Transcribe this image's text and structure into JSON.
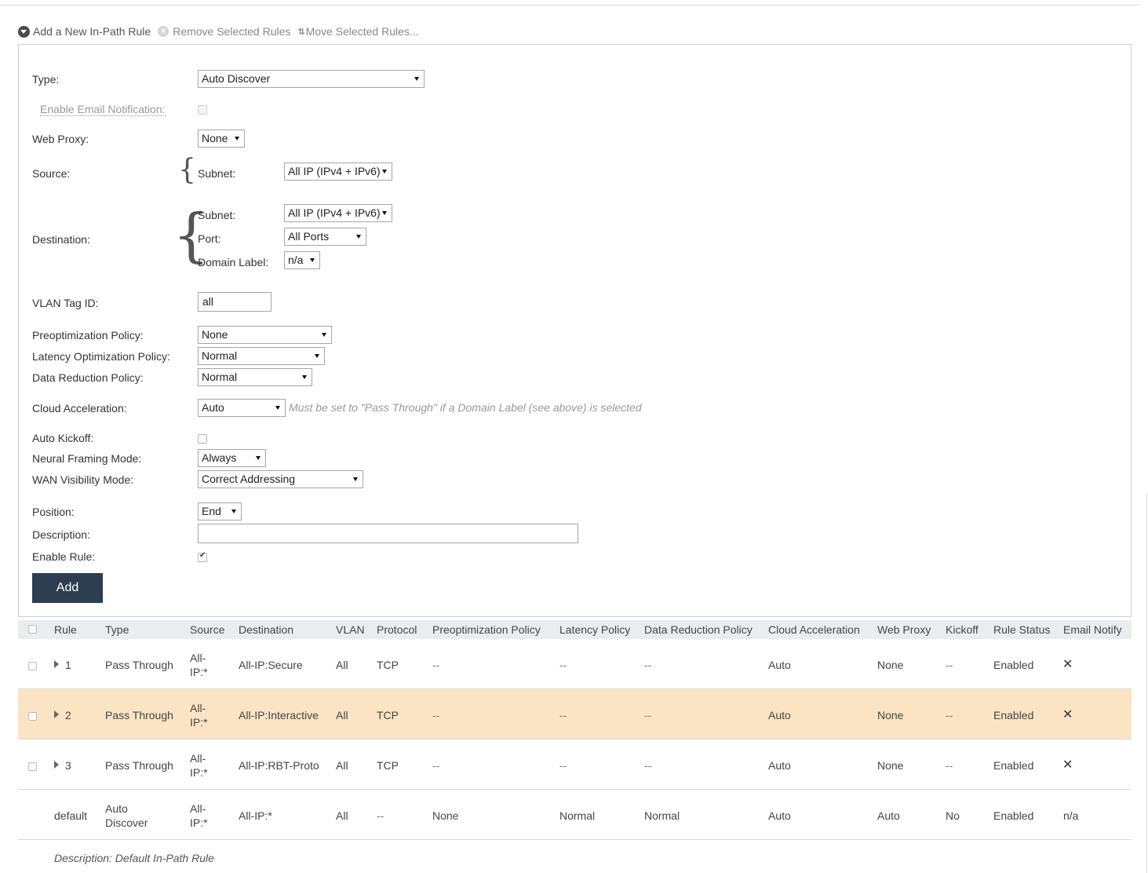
{
  "toolbar": {
    "add_label": "Add a New In-Path Rule",
    "remove_label": "Remove Selected Rules",
    "move_label": "Move Selected Rules..."
  },
  "form": {
    "type_label": "Type:",
    "type_value": "Auto Discover",
    "email_label": "Enable Email Notification:",
    "webproxy_label": "Web Proxy:",
    "webproxy_value": "None",
    "source_label": "Source:",
    "source_subnet_label": "Subnet:",
    "source_subnet_value": "All IP (IPv4 + IPv6)",
    "dest_label": "Destination:",
    "dest_subnet_label": "Subnet:",
    "dest_subnet_value": "All IP (IPv4 + IPv6)",
    "dest_port_label": "Port:",
    "dest_port_value": "All Ports",
    "dest_domain_label": "Domain Label:",
    "dest_domain_value": "n/a",
    "vlan_label": "VLAN Tag ID:",
    "vlan_value": "all",
    "preopt_label": "Preoptimization Policy:",
    "preopt_value": "None",
    "latency_label": "Latency Optimization Policy:",
    "latency_value": "Normal",
    "datared_label": "Data Reduction Policy:",
    "datared_value": "Normal",
    "cloud_label": "Cloud Acceleration:",
    "cloud_value": "Auto",
    "cloud_hint": "Must be set to \"Pass Through\" if a Domain Label (see above) is selected",
    "kickoff_label": "Auto Kickoff:",
    "neural_label": "Neural Framing Mode:",
    "neural_value": "Always",
    "wan_label": "WAN Visibility Mode:",
    "wan_value": "Correct Addressing",
    "position_label": "Position:",
    "position_value": "End",
    "description_label": "Description:",
    "description_value": "",
    "enable_label": "Enable Rule:",
    "add_button": "Add"
  },
  "table": {
    "headers": [
      "Rule",
      "Type",
      "Source",
      "Destination",
      "VLAN",
      "Protocol",
      "Preoptimization Policy",
      "Latency Policy",
      "Data Reduction Policy",
      "Cloud Acceleration",
      "Web Proxy",
      "Kickoff",
      "Rule Status",
      "Email Notify"
    ],
    "rows": [
      {
        "rule": "1",
        "type": "Pass Through",
        "src1": "All-",
        "src2": "IP:*",
        "dest": "All-IP:Secure",
        "vlan": "All",
        "proto": "TCP",
        "preopt": "--",
        "latency": "--",
        "datared": "--",
        "cloud": "Auto",
        "proxy": "None",
        "kickoff": "--",
        "status": "Enabled",
        "email": "✕"
      },
      {
        "rule": "2",
        "type": "Pass Through",
        "src1": "All-",
        "src2": "IP:*",
        "dest": "All-IP:Interactive",
        "vlan": "All",
        "proto": "TCP",
        "preopt": "--",
        "latency": "--",
        "datared": "--",
        "cloud": "Auto",
        "proxy": "None",
        "kickoff": "--",
        "status": "Enabled",
        "email": "✕"
      },
      {
        "rule": "3",
        "type": "Pass Through",
        "src1": "All-",
        "src2": "IP:*",
        "dest": "All-IP:RBT-Proto",
        "vlan": "All",
        "proto": "TCP",
        "preopt": "--",
        "latency": "--",
        "datared": "--",
        "cloud": "Auto",
        "proxy": "None",
        "kickoff": "--",
        "status": "Enabled",
        "email": "✕"
      },
      {
        "rule": "default",
        "type1": "Auto",
        "type2": "Discover",
        "src1": "All-",
        "src2": "IP:*",
        "dest": "All-IP:*",
        "vlan": "All",
        "proto": "--",
        "preopt": "None",
        "latency": "Normal",
        "datared": "Normal",
        "cloud": "Auto",
        "proxy": "Auto",
        "kickoff": "No",
        "status": "Enabled",
        "email": "n/a"
      }
    ],
    "default_description": "Description: Default In-Path Rule"
  }
}
